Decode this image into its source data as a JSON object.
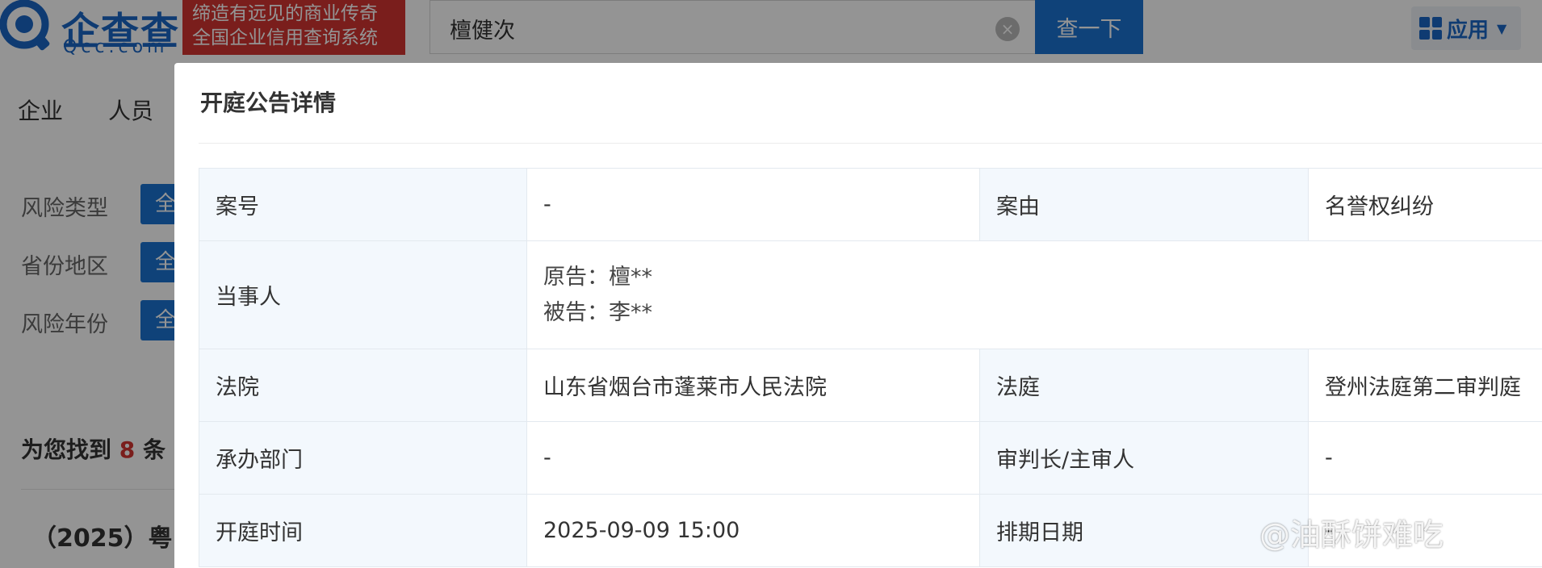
{
  "header": {
    "logo_text": "企查查",
    "logo_sub": "Qcc.com",
    "slogan_line1": "缔造有远见的商业传奇",
    "slogan_line2": "全国企业信用查询系统",
    "search_value": "檀健次",
    "search_button": "查一下",
    "apps_label": "应用"
  },
  "nav": {
    "items": [
      "企业",
      "人员"
    ]
  },
  "filters": [
    {
      "label": "风险类型",
      "chip": "全"
    },
    {
      "label": "省份地区",
      "chip": "全"
    },
    {
      "label": "风险年份",
      "chip": "全"
    }
  ],
  "results": {
    "prefix": "为您找到",
    "count": "8",
    "suffix": "条",
    "first_case": "（2025）粤"
  },
  "modal": {
    "title": "开庭公告详情",
    "rows": {
      "case_no_label": "案号",
      "case_no_value": "-",
      "cause_label": "案由",
      "cause_value": "名誉权纠纷",
      "party_label": "当事人",
      "plaintiff": "原告：檀**",
      "defendant": "被告：李**",
      "court_label": "法院",
      "court_value": "山东省烟台市蓬莱市人民法院",
      "tribunal_label": "法庭",
      "tribunal_value": "登州法庭第二审判庭",
      "dept_label": "承办部门",
      "dept_value": "-",
      "judge_label": "审判长/主审人",
      "judge_value": "-",
      "hearing_label": "开庭时间",
      "hearing_value": "2025-09-09 15:00",
      "schedule_label": "排期日期",
      "schedule_value": "-"
    }
  },
  "watermark": "@油酥饼难吃",
  "colors": {
    "brand_blue": "#1a73d1",
    "slogan_red": "#d23531",
    "label_bg": "#f3f8fd"
  }
}
